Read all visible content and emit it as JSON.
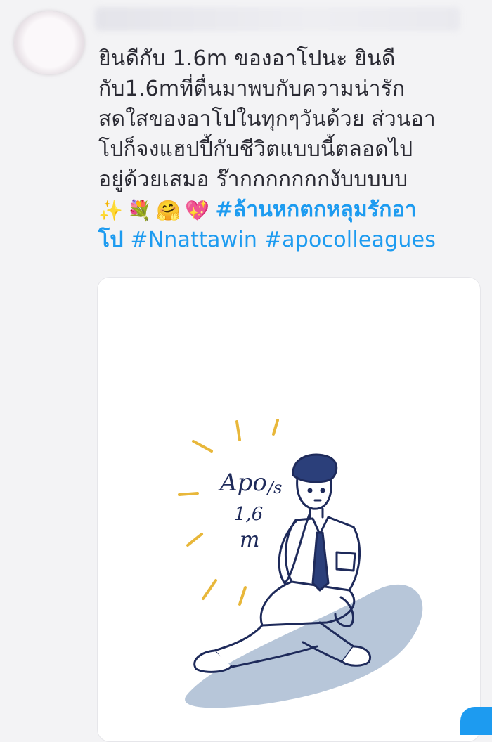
{
  "tweet": {
    "lines": [
      "ยินดีกับ 1.6m ของอาโปนะ ยินดี",
      "กับ1.6mที่ตื่นมาพบกับความน่ารัก",
      "สดใสของอาโปในทุกๆวันด้วย ส่วนอา",
      "โปก็จงแฮปปี้กับชีวิตแบบนี้ตลอดไป",
      "อยู่ด้วยเสมอ ร๊ากกกกกกกงับบบบบ"
    ],
    "emojis": [
      "✨",
      "💐",
      "🤗",
      "💖"
    ],
    "hashtag_line1": "#ล้านหกตกหลุมรักอา",
    "hashtag_line2_start": "โป",
    "hashtag_nnattawin": "#Nnattawin",
    "hashtag_apocolleagues": "#apocolleagues"
  },
  "illustration": {
    "text_apo": "Apo",
    "text_s": "/s",
    "text_1": "1,6",
    "text_m": "m"
  },
  "colors": {
    "hashtag": "#1d9bf0",
    "text": "#2a2a33",
    "ink": "#1e2a5a",
    "shadow": "#b7c6d9",
    "rays": "#e8b73a"
  }
}
